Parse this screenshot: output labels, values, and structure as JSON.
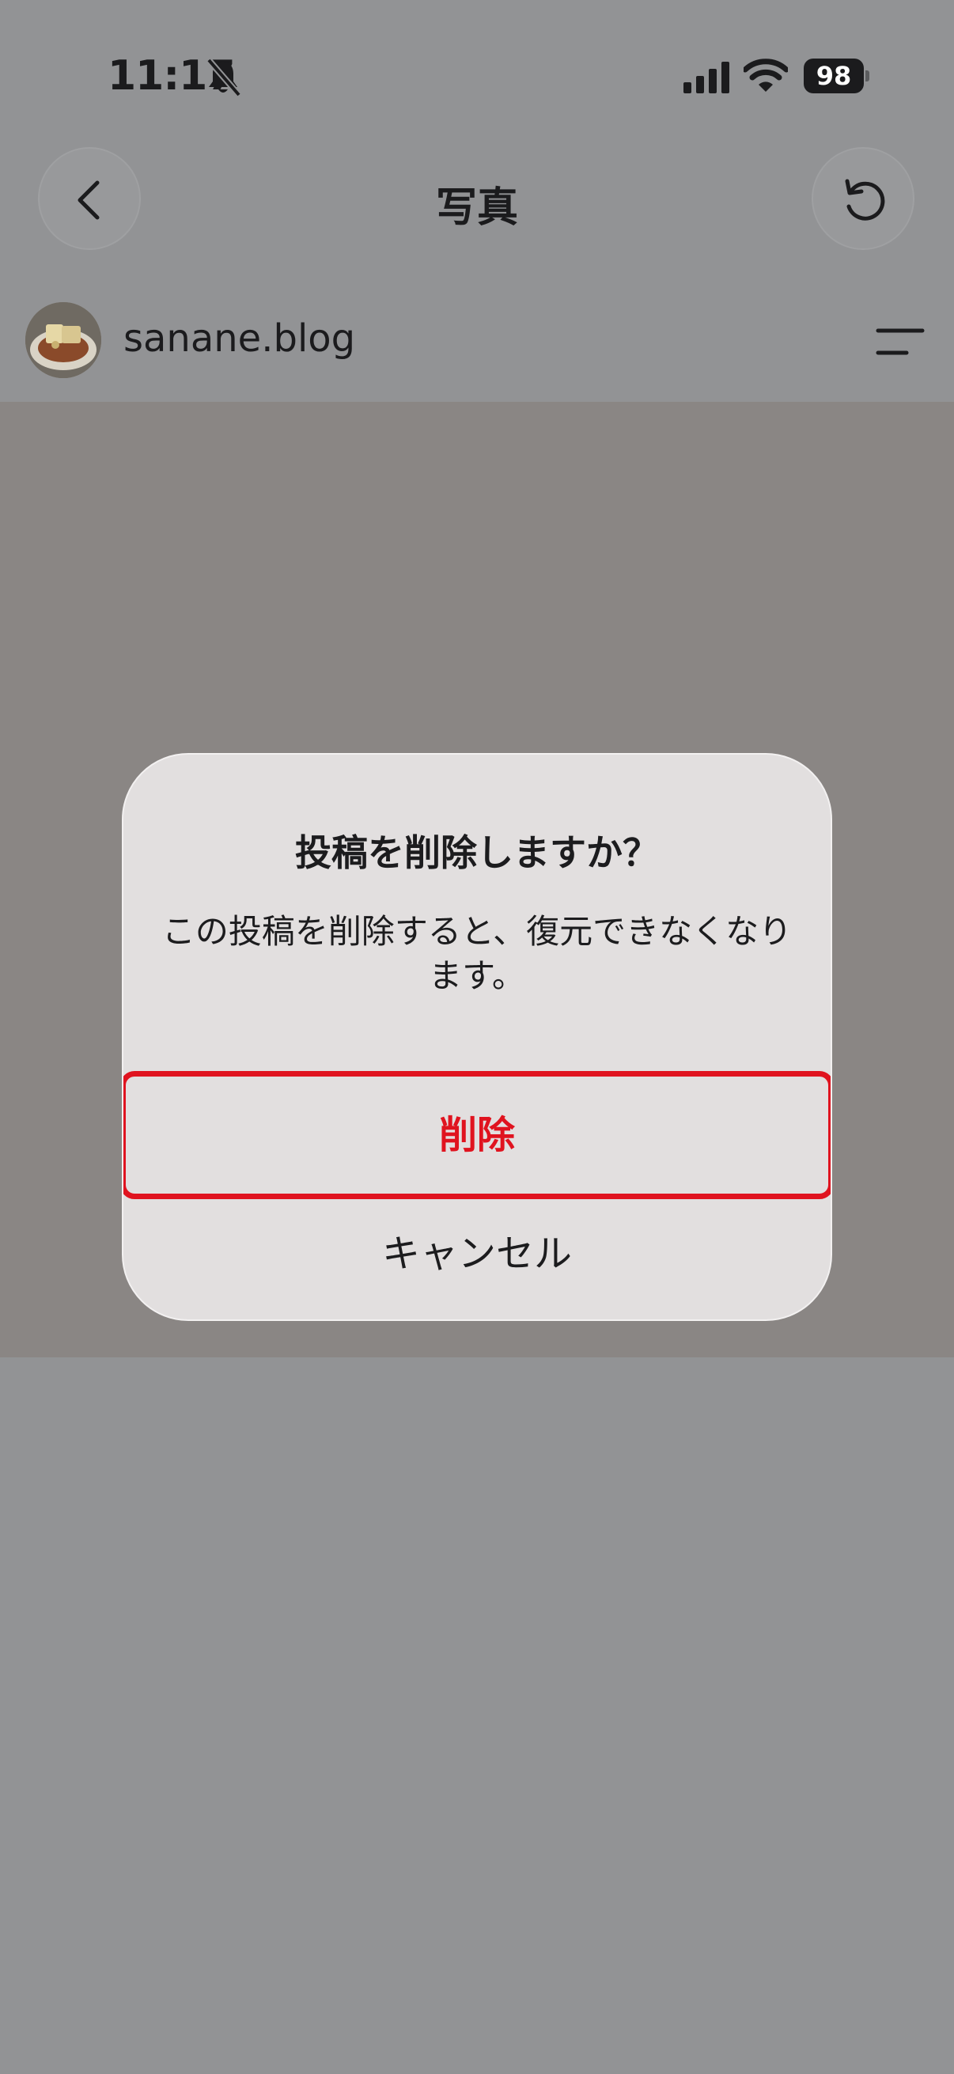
{
  "status_bar": {
    "time": "11:17",
    "battery": "98",
    "icons": [
      "bell-slash-icon",
      "cellular-signal-icon",
      "wifi-icon",
      "battery-icon"
    ]
  },
  "nav": {
    "title": "写真",
    "back_icon": "chevron-left-icon",
    "refresh_icon": "refresh-icon"
  },
  "post": {
    "username": "sanane.blog",
    "menu_icon": "menu-lines-icon"
  },
  "dialog": {
    "title": "投稿を削除しますか？",
    "message": "この投稿を削除すると、復元できなくなります。",
    "delete_label": "削除",
    "cancel_label": "キャンセル",
    "destructive_color": "#e0131f"
  }
}
